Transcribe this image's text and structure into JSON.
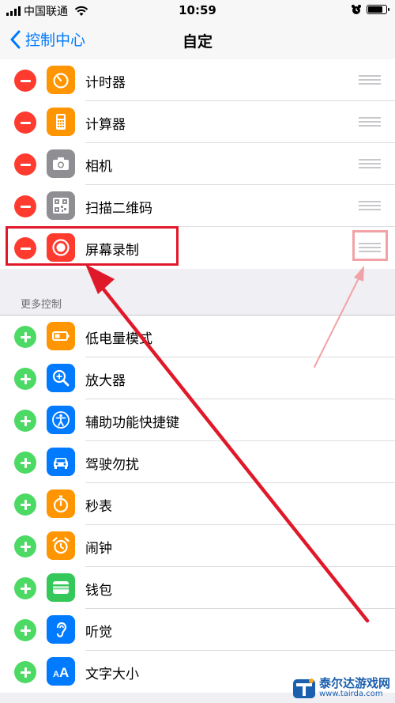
{
  "status_bar": {
    "carrier": "中国联通",
    "time": "10:59",
    "signal_bars": 4,
    "battery_level": 0.85
  },
  "nav": {
    "back_label": "控制中心",
    "title": "自定"
  },
  "included_controls": [
    {
      "label": "计时器",
      "icon": "timer-icon",
      "color": "#ff9500"
    },
    {
      "label": "计算器",
      "icon": "calculator-icon",
      "color": "#ff9500"
    },
    {
      "label": "相机",
      "icon": "camera-icon",
      "color": "#8e8e93"
    },
    {
      "label": "扫描二维码",
      "icon": "qr-code-icon",
      "color": "#8e8e93"
    },
    {
      "label": "屏幕录制",
      "icon": "screen-record-icon",
      "color": "#ff3b30"
    }
  ],
  "more_controls_header": "更多控制",
  "more_controls": [
    {
      "label": "低电量模式",
      "icon": "low-power-icon",
      "color": "#ff9500"
    },
    {
      "label": "放大器",
      "icon": "magnifier-icon",
      "color": "#007aff"
    },
    {
      "label": "辅助功能快捷键",
      "icon": "accessibility-icon",
      "color": "#007aff"
    },
    {
      "label": "驾驶勿扰",
      "icon": "car-icon",
      "color": "#007aff"
    },
    {
      "label": "秒表",
      "icon": "stopwatch-icon",
      "color": "#ff9500"
    },
    {
      "label": "闹钟",
      "icon": "alarm-icon",
      "color": "#ff9500"
    },
    {
      "label": "钱包",
      "icon": "wallet-icon",
      "color": "#34c759"
    },
    {
      "label": "听觉",
      "icon": "hearing-icon",
      "color": "#007aff"
    },
    {
      "label": "文字大小",
      "icon": "text-size-icon",
      "color": "#007aff"
    }
  ],
  "watermark": {
    "name": "泰尔达游戏网",
    "url": "www.tairda.com"
  }
}
